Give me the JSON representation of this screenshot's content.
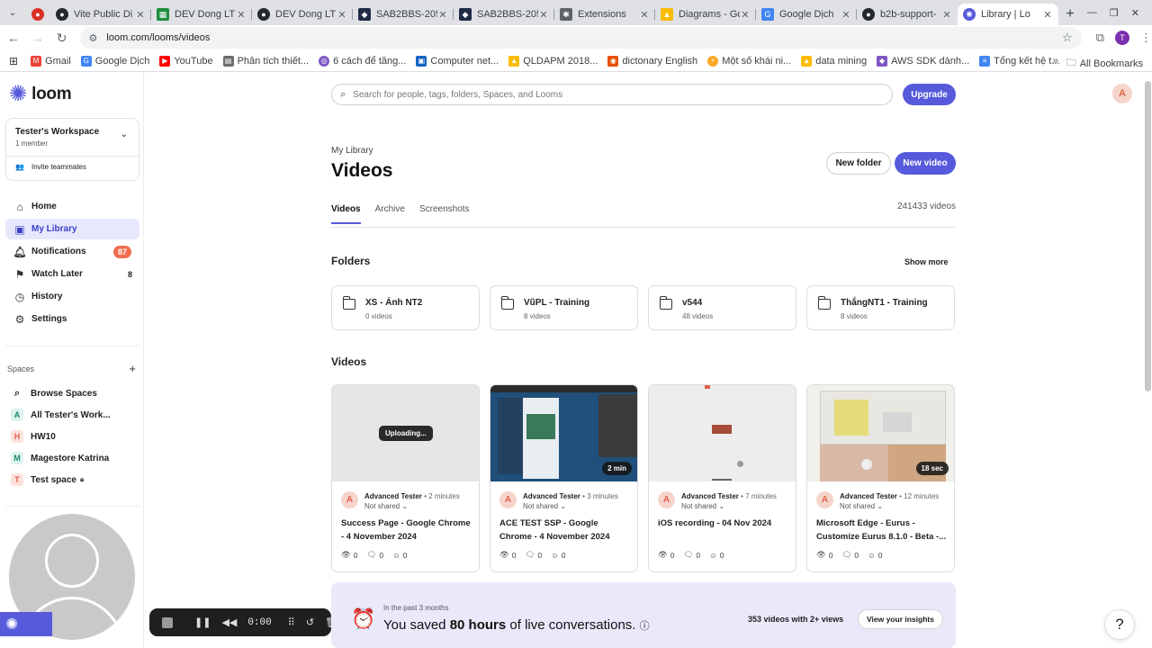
{
  "browser": {
    "tabs": [
      {
        "label": "",
        "icon": "record-icon",
        "color": "#d93025"
      },
      {
        "label": "Vite Public Di",
        "icon": "github-icon",
        "color": "#24292f"
      },
      {
        "label": "DEV Dong LT",
        "icon": "sheets-icon",
        "color": "#1e8e3e"
      },
      {
        "label": "DEV Dong LT",
        "icon": "github-icon",
        "color": "#24292f"
      },
      {
        "label": "SAB2BBS-205",
        "icon": "jira-icon",
        "color": "#1f2a44"
      },
      {
        "label": "SAB2BBS-205",
        "icon": "jira-icon",
        "color": "#1f2a44"
      },
      {
        "label": "Extensions",
        "icon": "puzzle-icon",
        "color": "#5f6368"
      },
      {
        "label": "Diagrams - Go",
        "icon": "drive-icon",
        "color": "#fbbc04"
      },
      {
        "label": "Google Dịch",
        "icon": "translate-icon",
        "color": "#4285f4"
      },
      {
        "label": "b2b-support-",
        "icon": "github-icon",
        "color": "#24292f"
      },
      {
        "label": "Library | Lo",
        "icon": "loom-icon",
        "color": "#565adb"
      }
    ],
    "url": "loom.com/looms/videos",
    "bookmarks": [
      {
        "label": "Gmail",
        "color": "#ea4335"
      },
      {
        "label": "Google Dịch",
        "color": "#4285f4"
      },
      {
        "label": "YouTube",
        "color": "#ff0000"
      },
      {
        "label": "Phân tích thiết...",
        "color": "#6d6d6d"
      },
      {
        "label": "6 cách để tăng...",
        "color": "#7e57c2"
      },
      {
        "label": "Computer net...",
        "color": "#1565c0"
      },
      {
        "label": "QLDAPM 2018...",
        "color": "#fbbc04"
      },
      {
        "label": "dictonary English",
        "color": "#e65100"
      },
      {
        "label": "Một số khái ni...",
        "color": "#f9a825"
      },
      {
        "label": "data mining",
        "color": "#fbbc04"
      },
      {
        "label": "AWS SDK dành...",
        "color": "#7e57c2"
      },
      {
        "label": "Tổng kết hệ t...",
        "color": "#4285f4"
      }
    ],
    "all_bookmarks": "All Bookmarks",
    "profile_initial": "T"
  },
  "brand": {
    "name": "loom",
    "accent": "#565adb"
  },
  "workspace": {
    "name": "Tester's Workspace",
    "members": "1 member",
    "invite": "Invite teammates"
  },
  "nav": {
    "home": "Home",
    "library": "My Library",
    "notifications": "Notifications",
    "notifications_count": "87",
    "watch_later": "Watch Later",
    "watch_later_count": "8",
    "history": "History",
    "settings": "Settings"
  },
  "spaces": {
    "heading": "Spaces",
    "browse": "Browse Spaces",
    "items": [
      {
        "initial": "A",
        "label": "All Tester's Work...",
        "bg": "#dff3ee",
        "fg": "#1a8a6e"
      },
      {
        "initial": "H",
        "label": "HW10",
        "bg": "#fde2dc",
        "fg": "#e0604a"
      },
      {
        "initial": "M",
        "label": "Magestore Katrina",
        "bg": "#dff3ee",
        "fg": "#1a8a6e"
      },
      {
        "initial": "T",
        "label": "Test space",
        "bg": "#fde2dc",
        "fg": "#e0604a"
      }
    ]
  },
  "recorder": {
    "time": "0:00"
  },
  "header": {
    "search_placeholder": "Search for people, tags, folders, Spaces, and Looms",
    "upgrade": "Upgrade",
    "user_initial": "A"
  },
  "page": {
    "breadcrumb": "My Library",
    "title": "Videos",
    "new_folder": "New folder",
    "new_video": "New video",
    "tabs": [
      "Videos",
      "Archive",
      "Screenshots"
    ],
    "video_count": "241433 videos"
  },
  "folders": {
    "heading": "Folders",
    "show_more": "Show more",
    "items": [
      {
        "name": "XS - Ánh NT2",
        "count": "0 videos"
      },
      {
        "name": "VũPL - Training",
        "count": "8 videos"
      },
      {
        "name": "v544",
        "count": "48 videos"
      },
      {
        "name": "ThắngNT1 - Training",
        "count": "8 videos"
      }
    ]
  },
  "videos": {
    "heading": "Videos",
    "items": [
      {
        "author": "Advanced Tester",
        "ago": "2 minutes",
        "shared": "Not shared",
        "title": "Success Page - Google Chrome - 4 November 2024",
        "views": "0",
        "comments": "0",
        "reactions": "0",
        "badge": "Uploading...",
        "duration": ""
      },
      {
        "author": "Advanced Tester",
        "ago": "3 minutes",
        "shared": "Not shared",
        "title": "ACE TEST SSP - Google Chrome - 4 November 2024",
        "views": "0",
        "comments": "0",
        "reactions": "0",
        "badge": "",
        "duration": "2 min"
      },
      {
        "author": "Advanced Tester",
        "ago": "7 minutes",
        "shared": "Not shared",
        "title": "iOS recording - 04 Nov 2024",
        "views": "0",
        "comments": "0",
        "reactions": "0",
        "badge": "",
        "duration": ""
      },
      {
        "author": "Advanced Tester",
        "ago": "12 minutes",
        "shared": "Not shared",
        "title": "Microsoft Edge - Eurus - Customize Eurus 8.1.0 - Beta -...",
        "views": "0",
        "comments": "0",
        "reactions": "0",
        "badge": "",
        "duration": "18 sec"
      }
    ]
  },
  "insights": {
    "period": "In the past 3 months",
    "saved_prefix": "You saved",
    "saved_hours": "80 hours",
    "saved_suffix": "of live conversations.",
    "views": "353 videos with 2+ views",
    "button": "View your insights"
  },
  "help": "?"
}
